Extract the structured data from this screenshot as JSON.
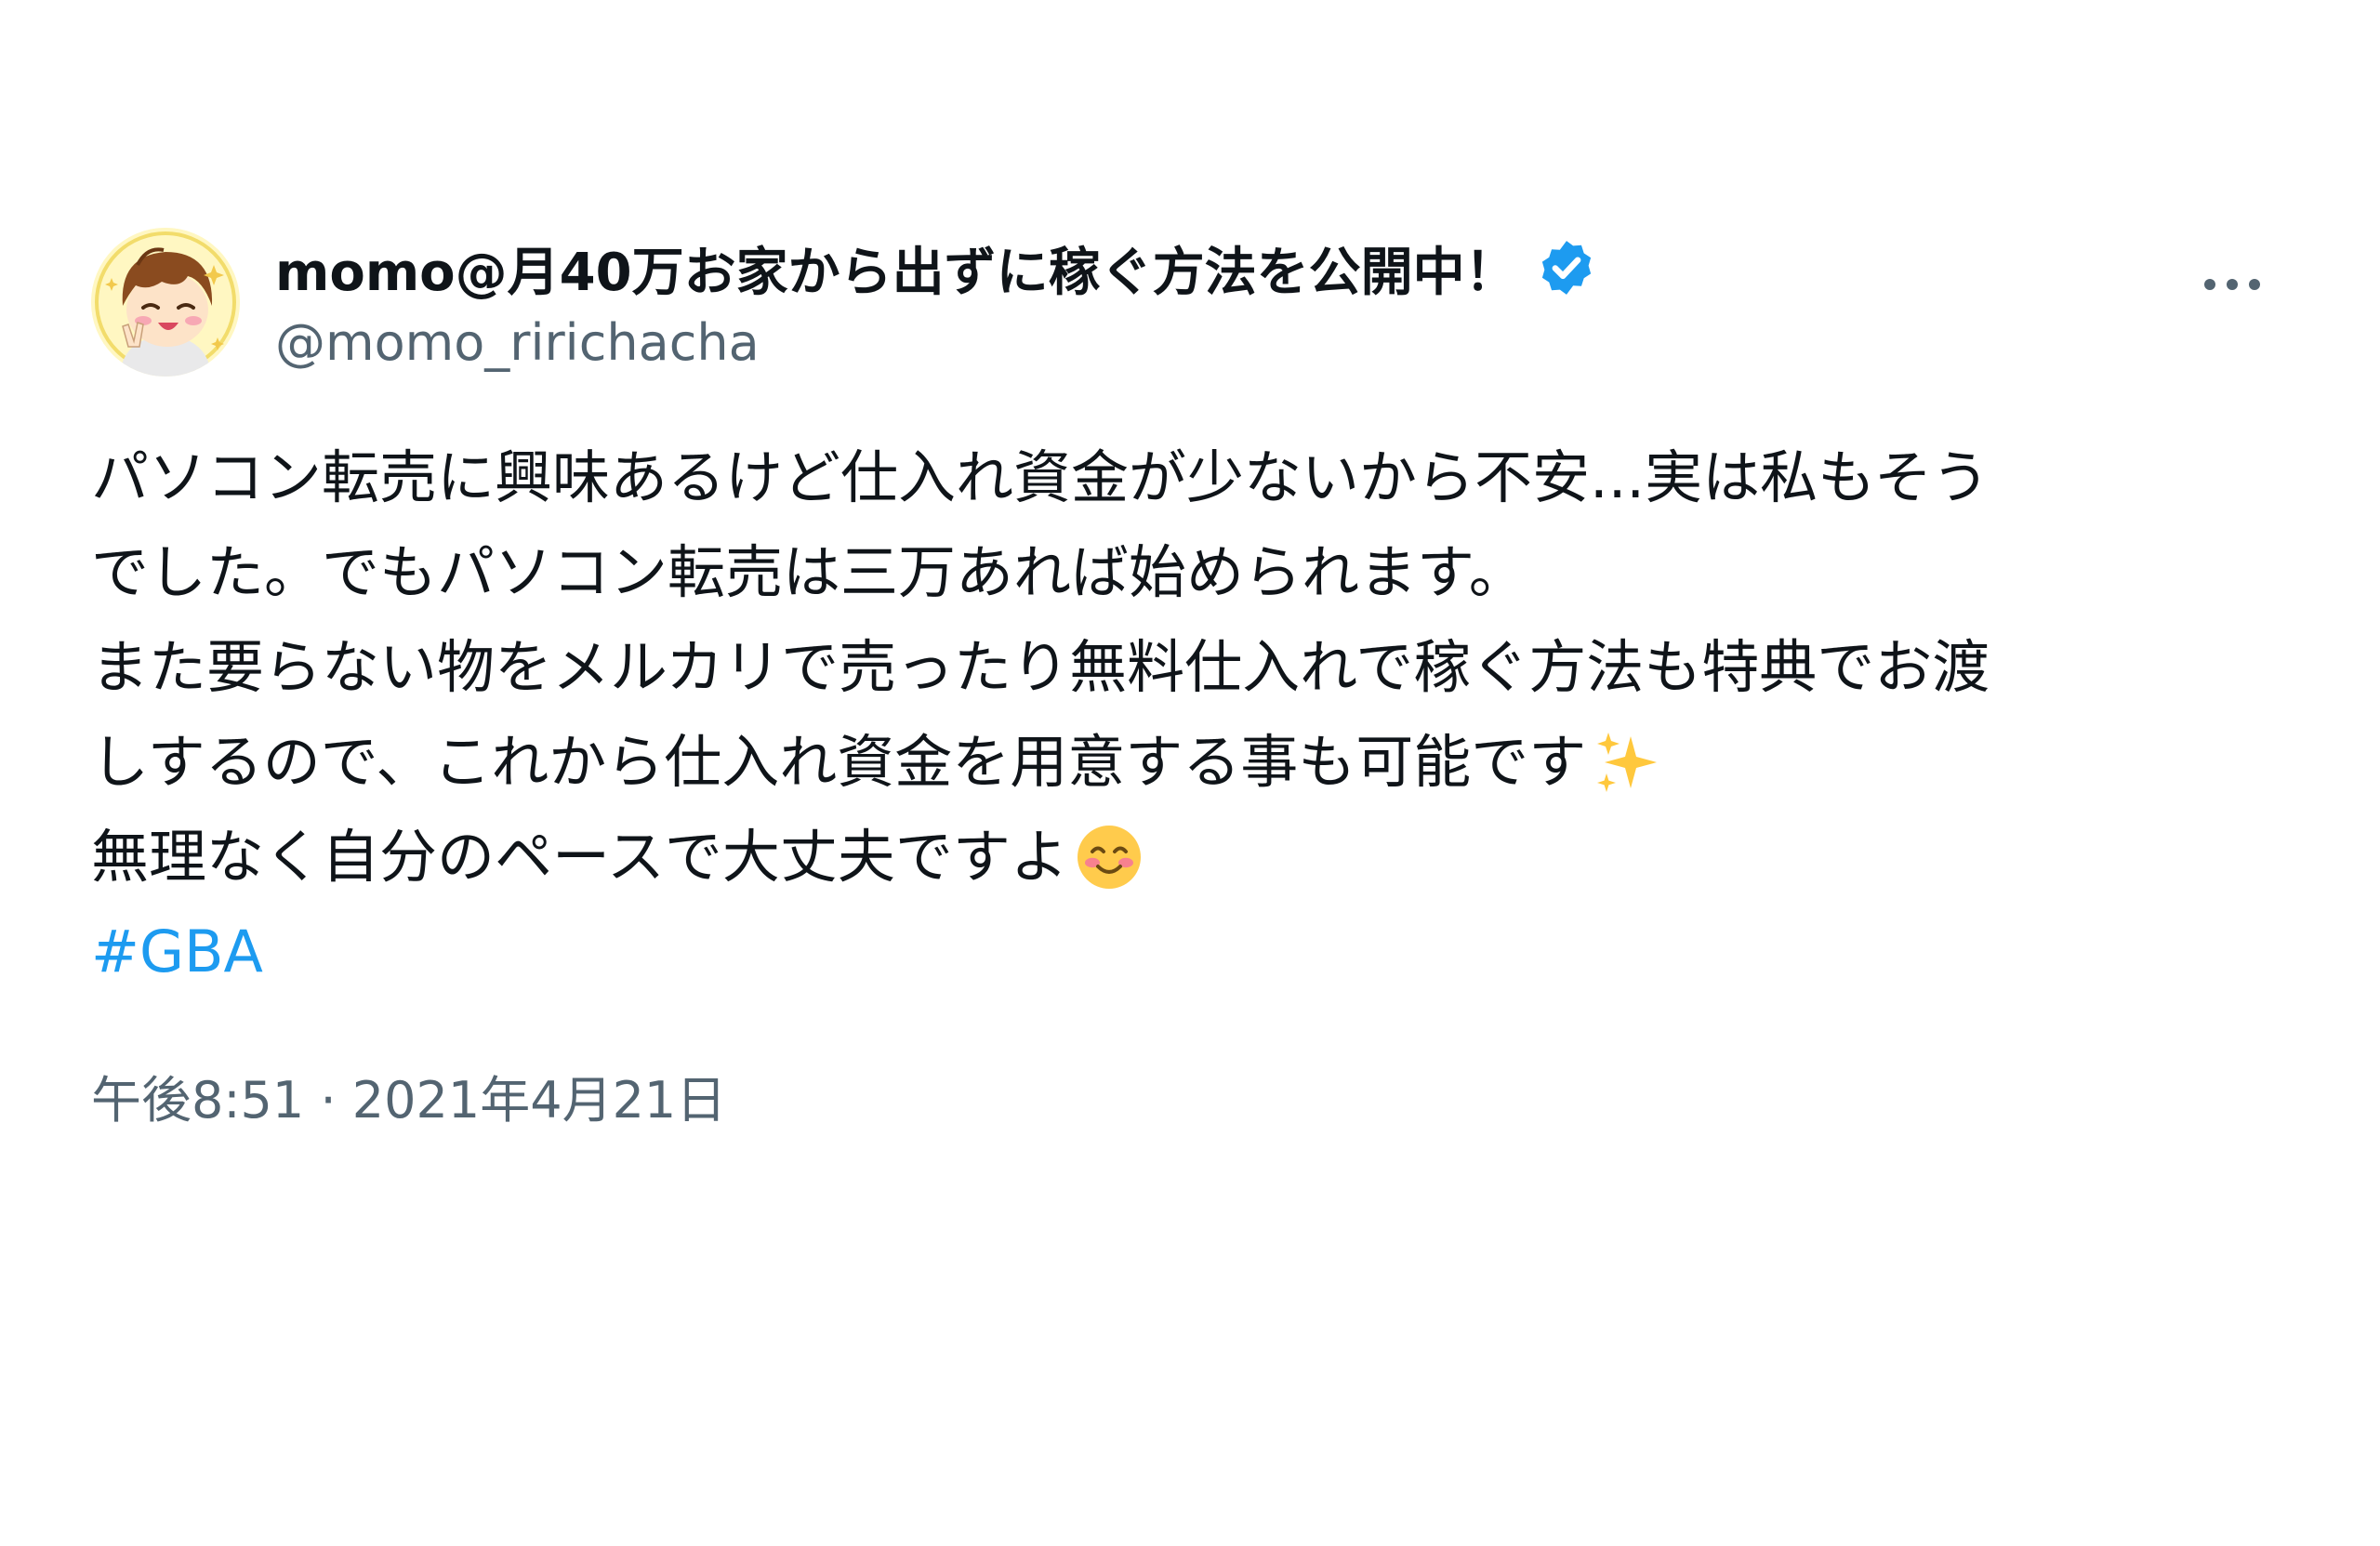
{
  "tweet": {
    "author": {
      "display_name": "momo@月40万お家から出ずに稼ぐ方法を公開中！",
      "handle": "@momo_ririchacha",
      "verified_icon": "verified-badge-icon",
      "avatar_icon": "cartoon-avatar"
    },
    "more_icon": "more-options-icon",
    "body_lines": [
      "パソコン転売に興味あるけど仕入れ資金が少ないから不安...実は私もそう",
      "でした。でもパソコン転売は三万あれば始められます。",
      "また要らない物をメルカリで売ったり無料仕入れで稼ぐ方法も特典でお渡",
      "しするので、これから仕入れ資金を用意する事も可能です",
      "無理なく自分のペースで大丈夫ですよ"
    ],
    "emojis": [
      "sparkles-emoji",
      "smiling-face-emoji"
    ],
    "hashtag": "#GBA",
    "time": "午後8:51",
    "separator": "·",
    "date": "2021年4月21日"
  },
  "colors": {
    "text": "#0f1419",
    "secondary": "#536471",
    "link": "#1d9bf0",
    "verified": "#1d9bf0"
  }
}
